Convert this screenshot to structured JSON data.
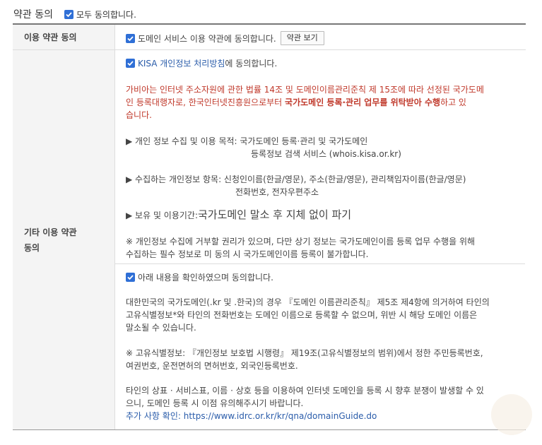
{
  "header": {
    "title": "약관 동의",
    "agree_all": "모두 동의합니다."
  },
  "rows": {
    "terms_label": "이용 약관 동의",
    "other_label_1": "기타 이용 약관",
    "other_label_2": "동의"
  },
  "terms": {
    "agree_text": "도메인 서비스 이용 약관에 동의합니다.",
    "view_button": "약관 보기"
  },
  "kisa": {
    "link": "KISA 개인정보 처리방침",
    "suffix": "에 동의합니다.",
    "red_1": "가비아는 인터넷 주소자원에 관한 법률 14조 및 도메인이름관리준칙 제 15조에 따라 선정된 국가도메",
    "red_2a": "인 등록대행자로, 한국인터넷진흥원으로부터 ",
    "red_2b": "국가도메인 등록·관리 업무를 위탁받아 수행",
    "red_2c": "하고 있",
    "red_3": "습니다.",
    "purpose_1": "▶ 개인 정보 수집 및 이용 목적: 국가도메인 등록·관리 및 국가도메인",
    "purpose_2": "등록정보 검색 서비스 (whois.kisa.or.kr)",
    "items_1": "▶ 수집하는 개인정보 항목: 신청인이름(한글/영문), 주소(한글/영문), 관리책임자이름(한글/영문)",
    "items_2": "전화번호, 전자우편주소",
    "period_label": "▶ 보유 및 이용기간: ",
    "period_value": "국가도메인 말소 후 지체 없이 파기",
    "note_1": "※ 개인정보 수집에 거부할 권리가 있으며, 다만 상기 정보는 국가도메인이름 등록 업무 수행을 위해",
    "note_2": "수집하는 필수 정보로 미 동의 시 국가도메인이름 등록이 불가합니다."
  },
  "confirm": {
    "agree_text": "아래 내용을 확인하였으며 동의합니다.",
    "p1_1": "대한민국의 국가도메인(.kr 및 .한국)의 경우 『도메인 이름관리준칙』 제5조 제4항에 의거하여 타인의",
    "p1_2": "고유식별정보*와 타인의 전화번호는 도메인 이름으로 등록할 수 없으며, 위반 시 해당 도메인 이름은",
    "p1_3": "말소될 수 있습니다.",
    "p2_1": "※ 고유식별정보: 『개인정보 보호법 시행령』 제19조(고유식별정보의 범위)에서 정한 주민등록번호,",
    "p2_2": "여권번호, 운전면허의 면허번호, 외국인등록번호.",
    "p3_1": "타인의 상표 · 서비스표, 이름 · 상호 등을 이용하여 인터넷 도메인을 등록 시 향후 분쟁이 발생할 수 있",
    "p3_2": "으니, 도메인 등록 시 이점 유의해주시기 바랍니다.",
    "more": "추가 사항 확인: https://www.idrc.or.kr/kr/qna/domainGuide.do"
  },
  "colors": {
    "checkbox": "#2f6fd6",
    "red": "#c0392b",
    "link": "#2a5caa"
  }
}
